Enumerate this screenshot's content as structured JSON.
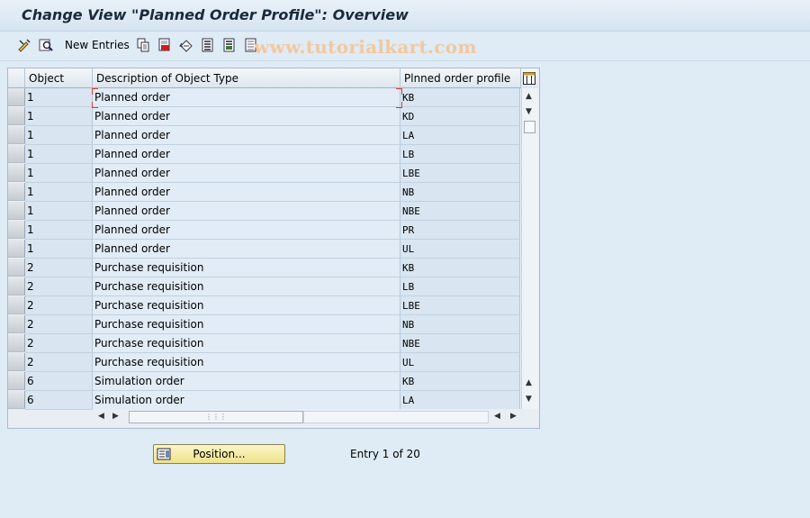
{
  "window": {
    "title": "Change View \"Planned Order Profile\": Overview"
  },
  "toolbar": {
    "icons": [
      "display-change-icon",
      "details-icon",
      "copy-icon",
      "delete-icon",
      "undo-icon",
      "select-all-icon",
      "select-block-icon",
      "deselect-all-icon"
    ],
    "new_entries_label": "New Entries"
  },
  "watermark": "www.tutorialkart.com",
  "table": {
    "columns": [
      "Object",
      "Description of Object Type",
      "Plnned order profile"
    ],
    "rows": [
      {
        "object": "1",
        "description": "Planned order",
        "profile": "KB"
      },
      {
        "object": "1",
        "description": "Planned order",
        "profile": "KD"
      },
      {
        "object": "1",
        "description": "Planned order",
        "profile": "LA"
      },
      {
        "object": "1",
        "description": "Planned order",
        "profile": "LB"
      },
      {
        "object": "1",
        "description": "Planned order",
        "profile": "LBE"
      },
      {
        "object": "1",
        "description": "Planned order",
        "profile": "NB"
      },
      {
        "object": "1",
        "description": "Planned order",
        "profile": "NBE"
      },
      {
        "object": "1",
        "description": "Planned order",
        "profile": "PR"
      },
      {
        "object": "1",
        "description": "Planned order",
        "profile": "UL"
      },
      {
        "object": "2",
        "description": "Purchase requisition",
        "profile": "KB"
      },
      {
        "object": "2",
        "description": "Purchase requisition",
        "profile": "LB"
      },
      {
        "object": "2",
        "description": "Purchase requisition",
        "profile": "LBE"
      },
      {
        "object": "2",
        "description": "Purchase requisition",
        "profile": "NB"
      },
      {
        "object": "2",
        "description": "Purchase requisition",
        "profile": "NBE"
      },
      {
        "object": "2",
        "description": "Purchase requisition",
        "profile": "UL"
      },
      {
        "object": "6",
        "description": "Simulation order",
        "profile": "KB"
      },
      {
        "object": "6",
        "description": "Simulation order",
        "profile": "LA"
      }
    ]
  },
  "footer": {
    "position_label": "Position...",
    "entry_text": "Entry 1 of 20"
  },
  "colors": {
    "background": "#dfebf5",
    "button_yellow": "#efe18a",
    "focus_red": "#e23b2b"
  }
}
